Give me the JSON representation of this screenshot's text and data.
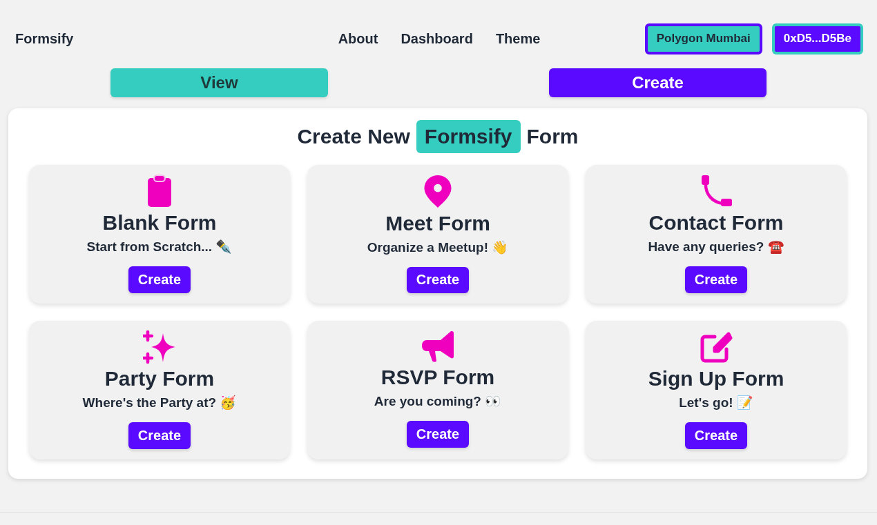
{
  "header": {
    "logo": "Formsify",
    "nav": [
      {
        "label": "About"
      },
      {
        "label": "Dashboard"
      },
      {
        "label": "Theme"
      }
    ],
    "network_button": "Polygon Mumbai",
    "wallet_button": "0xD5...D5Be"
  },
  "mode_tabs": [
    {
      "label": "View",
      "selected": false
    },
    {
      "label": "Create",
      "selected": true
    }
  ],
  "panel": {
    "title_before": "Create New",
    "title_highlight": "Formsify",
    "title_after": "Form",
    "templates": [
      {
        "title": "Blank Form",
        "subtitle": "Start from Scratch... ✒️",
        "button": "Create"
      },
      {
        "title": "Meet Form",
        "subtitle": "Organize a Meetup! 👋",
        "button": "Create"
      },
      {
        "title": "Contact Form",
        "subtitle": "Have any queries? ☎️",
        "button": "Create"
      },
      {
        "title": "Party Form",
        "subtitle": "Where's the Party at? 🥳",
        "button": "Create"
      },
      {
        "title": "RSVP Form",
        "subtitle": "Are you coming? 👀",
        "button": "Create"
      },
      {
        "title": "Sign Up Form",
        "subtitle": "Let's go! 📝",
        "button": "Create"
      }
    ]
  }
}
